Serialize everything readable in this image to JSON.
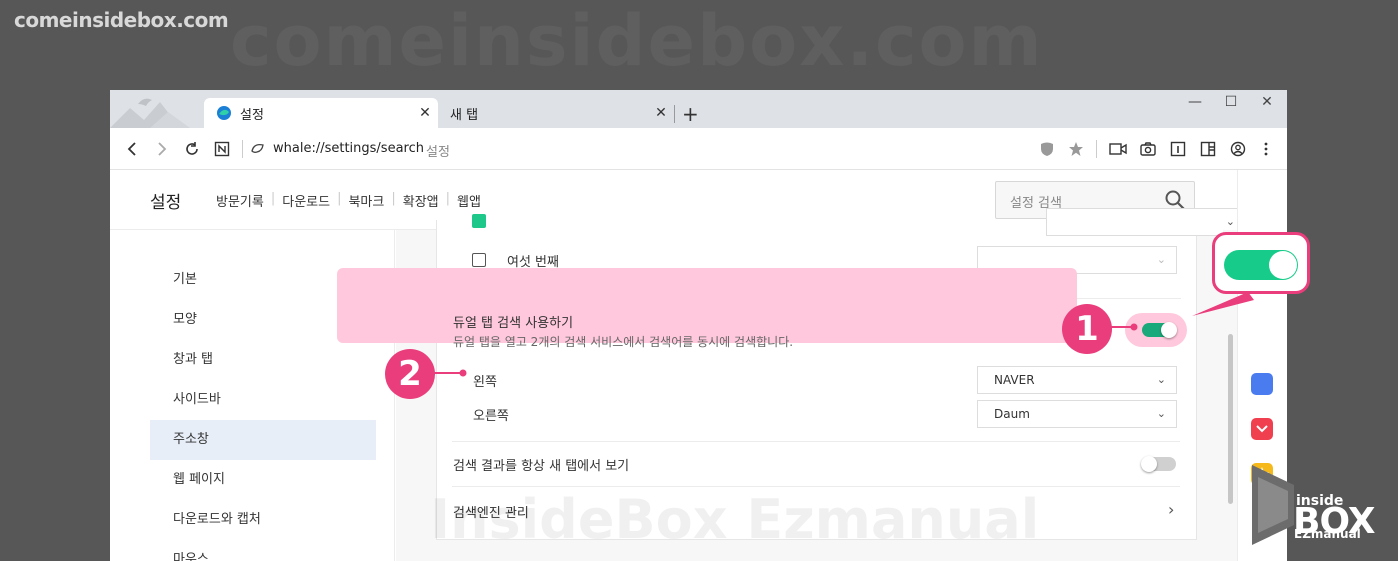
{
  "watermark": {
    "top_left": "comeinsidebox.com",
    "mid": "comeinsidebox.com",
    "bottom": "InsideBox Ezmanual"
  },
  "tabs": [
    {
      "label": "설정",
      "active": true
    },
    {
      "label": "새 탭",
      "active": false
    }
  ],
  "window_controls": {
    "minimize": "—",
    "maximize": "☐",
    "close": "✕"
  },
  "address_bar": {
    "url": "whale://settings/search",
    "suffix": "설정"
  },
  "settings_header": {
    "title": "설정",
    "nav": [
      "방문기록",
      "다운로드",
      "북마크",
      "확장앱",
      "웹앱"
    ],
    "search_placeholder": "설정 검색"
  },
  "left_menu": {
    "items": [
      "기본",
      "모양",
      "창과 탭",
      "사이드바",
      "주소창",
      "웹 페이지",
      "다운로드와 캡처",
      "마우스"
    ],
    "active_index": 4
  },
  "search_engines": {
    "sixth_label": "여섯 번째"
  },
  "dual_tab": {
    "title": "듀얼 탭 검색 사용하기",
    "description": "듀얼 탭을 열고 2개의 검색 서비스에서 검색어를 동시에 검색합니다.",
    "enabled": true,
    "left_label": "왼쪽",
    "left_value": "NAVER",
    "right_label": "오른쪽",
    "right_value": "Daum"
  },
  "new_tab_results": {
    "label": "검색 결과를 항상 새 탭에서 보기",
    "enabled": false
  },
  "engine_manage": {
    "label": "검색엔진 관리"
  },
  "callouts": {
    "badge1": "1",
    "badge2": "2"
  },
  "logo": {
    "inside": "inside",
    "box": "BOX",
    "ez": "EZmanual"
  },
  "colors": {
    "accent_pink": "#ea3d7c",
    "highlight_pink": "#ffc8dc",
    "toggle_green": "#1aa97a"
  }
}
